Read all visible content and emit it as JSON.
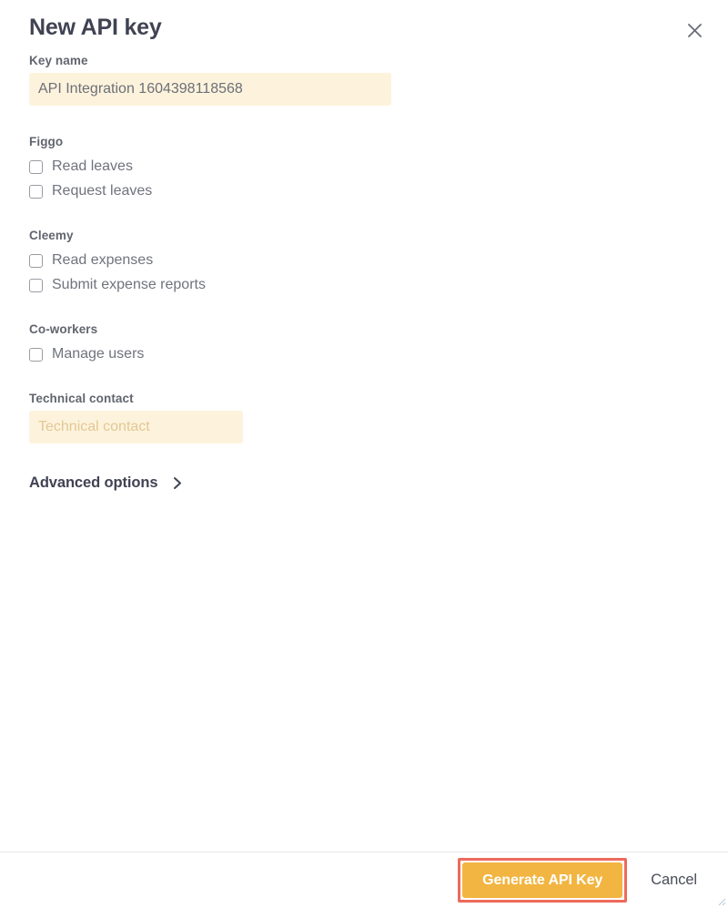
{
  "dialog": {
    "title": "New API key",
    "close_icon": "close-icon"
  },
  "key_name": {
    "label": "Key name",
    "value": "API Integration 1604398118568",
    "placeholder": "Key name"
  },
  "permission_groups": [
    {
      "name": "Figgo",
      "items": [
        {
          "label": "Read leaves",
          "checked": false
        },
        {
          "label": "Request leaves",
          "checked": false
        }
      ]
    },
    {
      "name": "Cleemy",
      "items": [
        {
          "label": "Read expenses",
          "checked": false
        },
        {
          "label": "Submit expense reports",
          "checked": false
        }
      ]
    },
    {
      "name": "Co-workers",
      "items": [
        {
          "label": "Manage users",
          "checked": false
        }
      ]
    }
  ],
  "technical_contact": {
    "label": "Technical contact",
    "value": "",
    "placeholder": "Technical contact"
  },
  "advanced_options": {
    "label": "Advanced options",
    "chevron_icon": "chevron-right-icon",
    "expanded": false
  },
  "footer": {
    "primary_label": "Generate API Key",
    "secondary_label": "Cancel"
  },
  "colors": {
    "accent": "#f2b541",
    "highlight": "#ed6a5a",
    "input_background": "#fdf3dc",
    "placeholder": "#e3c795",
    "title": "#3f4352",
    "label": "#62656f",
    "body_text": "#70737c",
    "divider": "#e8e8e8"
  }
}
